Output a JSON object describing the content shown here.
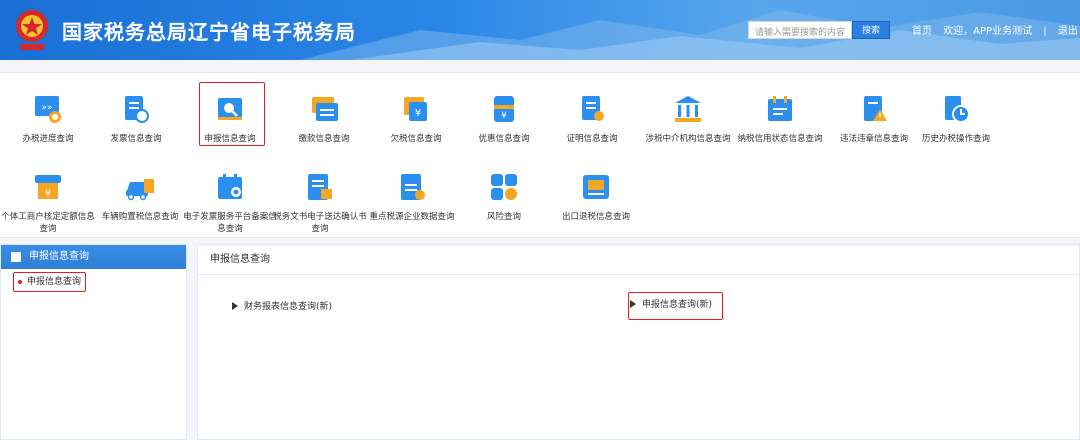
{
  "header": {
    "title": "国家税务总局辽宁省电子税务局",
    "search_placeholder": "请输入需要搜索的内容",
    "search_button": "搜索",
    "home": "首页",
    "welcome": "欢迎，APP业务测试",
    "divider": "|",
    "logout": "退出"
  },
  "categories": [
    {
      "label": "办税进度查询",
      "icon": "progress-icon"
    },
    {
      "label": "发票信息查询",
      "icon": "invoice-icon"
    },
    {
      "label": "申报信息查询",
      "icon": "declaration-icon"
    },
    {
      "label": "缴款信息查询",
      "icon": "payment-icon"
    },
    {
      "label": "欠税信息查询",
      "icon": "arrears-icon"
    },
    {
      "label": "优惠信息查询",
      "icon": "discount-icon"
    },
    {
      "label": "证明信息查询",
      "icon": "certificate-icon"
    },
    {
      "label": "涉税中介机构信息查询",
      "icon": "agency-icon"
    },
    {
      "label": "纳税信用状态信息查询",
      "icon": "credit-icon"
    },
    {
      "label": "违法违章信息查询",
      "icon": "violation-icon"
    },
    {
      "label": "历史办税操作查询",
      "icon": "history-icon"
    },
    {
      "label": "个体工商户核定定额信息查询",
      "icon": "merchant-icon"
    },
    {
      "label": "车辆购置税信息查询",
      "icon": "vehicle-icon"
    },
    {
      "label": "电子发票服务平台备案信息查询",
      "icon": "e-invoice-icon"
    },
    {
      "label": "税务文书电子送达确认书查询",
      "icon": "document-icon"
    },
    {
      "label": "重点税源企业数据查询",
      "icon": "key-source-icon"
    },
    {
      "label": "风险查询",
      "icon": "risk-icon"
    },
    {
      "label": "出口退税信息查询",
      "icon": "export-rebate-icon"
    }
  ],
  "sidebar": {
    "title": "申报信息查询",
    "items": [
      {
        "label": "申报信息查询"
      }
    ]
  },
  "main": {
    "title": "申报信息查询",
    "links": [
      {
        "label": "财务报表信息查询(新)"
      },
      {
        "label": "申报信息查询(新)"
      }
    ]
  },
  "colors": {
    "accent": "#2a7fe0",
    "highlight": "#e02020",
    "icon_blue": "#2b8ff0",
    "icon_orange": "#f5a623"
  }
}
